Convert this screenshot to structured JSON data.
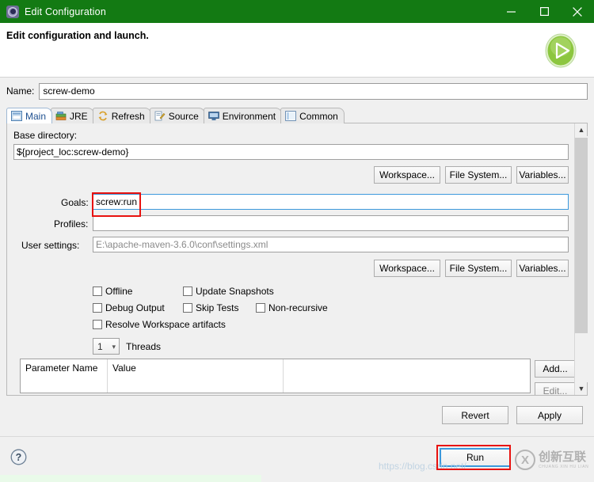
{
  "window": {
    "title": "Edit Configuration",
    "icon": "gear-icon",
    "controls": {
      "minimize": "minimize-icon",
      "maximize": "maximize-icon",
      "close": "close-icon"
    },
    "titlebar_color": "#137a13"
  },
  "header": {
    "title": "Edit configuration and launch.",
    "icon": "run-play-icon",
    "icon_color": "#78c043"
  },
  "name_field": {
    "label": "Name:",
    "value": "screw-demo"
  },
  "tabs": [
    {
      "label": "Main",
      "icon": "main-document-icon",
      "selected": true
    },
    {
      "label": "JRE",
      "icon": "jre-books-icon",
      "selected": false
    },
    {
      "label": "Refresh",
      "icon": "refresh-arrows-icon",
      "selected": false
    },
    {
      "label": "Source",
      "icon": "source-pencil-icon",
      "selected": false
    },
    {
      "label": "Environment",
      "icon": "environment-monitor-icon",
      "selected": false
    },
    {
      "label": "Common",
      "icon": "common-window-icon",
      "selected": false
    }
  ],
  "main_tab": {
    "base_directory": {
      "label": "Base directory:",
      "value": "${project_loc:screw-demo}",
      "buttons": [
        "Workspace...",
        "File System...",
        "Variables..."
      ]
    },
    "goals": {
      "label": "Goals:",
      "value": "screw:run",
      "focused": true,
      "highlighted": true
    },
    "profiles": {
      "label": "Profiles:",
      "value": ""
    },
    "user_settings": {
      "label": "User settings:",
      "value": "E:\\apache-maven-3.6.0\\conf\\settings.xml",
      "buttons": [
        "Workspace...",
        "File System...",
        "Variables..."
      ]
    },
    "checkboxes": [
      {
        "label": "Offline",
        "checked": false
      },
      {
        "label": "Update Snapshots",
        "checked": false
      },
      {
        "label": "Debug Output",
        "checked": false
      },
      {
        "label": "Skip Tests",
        "checked": false
      },
      {
        "label": "Non-recursive",
        "checked": false
      },
      {
        "label": "Resolve Workspace artifacts",
        "checked": false
      }
    ],
    "threads": {
      "value": "1",
      "label": "Threads"
    },
    "parameters_table": {
      "columns": [
        "Parameter Name",
        "Value",
        ""
      ],
      "rows": []
    },
    "table_buttons": [
      "Add...",
      "Edit..."
    ]
  },
  "footer": {
    "revert": "Revert",
    "apply": "Apply",
    "run": "Run",
    "help_icon": "help-question-icon",
    "run_highlighted": true
  },
  "watermarks": {
    "url": "https://blog.csdn.net/",
    "brand_cn": "创新互联",
    "brand_pinyin": "CHUANG XIN HU LIAN",
    "brand_mark": "X"
  },
  "annotation_color": "#e8120f"
}
